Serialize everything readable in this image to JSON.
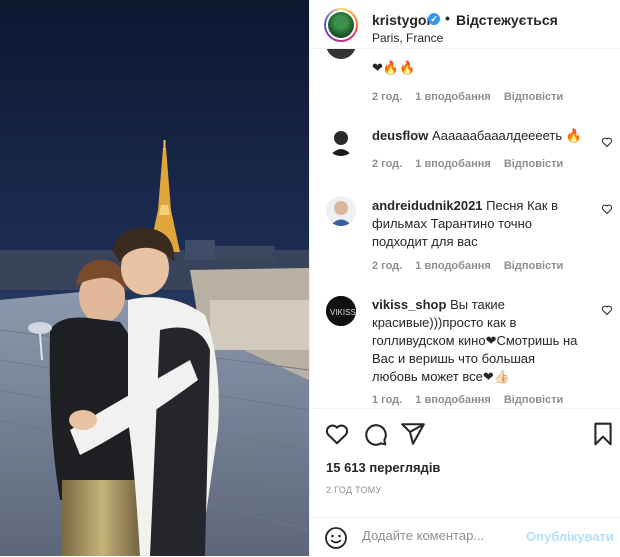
{
  "post": {
    "username": "kristygor",
    "verified": true,
    "separator": "•",
    "follow_status": "Відстежується",
    "location": "Paris, France"
  },
  "comments": [
    {
      "username": "",
      "text": "❤🔥🔥",
      "time": "2 год.",
      "likes": "1 вподобання",
      "reply": "Відповісти"
    },
    {
      "username": "deusflow",
      "text": "Аааааабааалдееееть 🔥",
      "time": "2 год.",
      "likes": "1 вподобання",
      "reply": "Відповісти"
    },
    {
      "username": "andreidudnik2021",
      "text": "Песня Как в фильмах Тарантино точно подходит для вас",
      "time": "2 год.",
      "likes": "1 вподобання",
      "reply": "Відповісти"
    },
    {
      "username": "vikiss_shop",
      "text": "Вы такие красивые)))просто как в голливудском кино❤Смотришь на Вас и веришь что большая любовь может все❤👍🏻",
      "time": "1 год.",
      "likes": "1 вподобання",
      "reply": "Відповісти"
    }
  ],
  "stats": {
    "views": "15 613 переглядів",
    "time_ago": "2 ГОД ТОМУ"
  },
  "add_comment": {
    "placeholder": "Додайте коментар...",
    "publish_label": "Опублікувати"
  },
  "icons": {
    "like": "heart-icon",
    "comment": "comment-icon",
    "share": "share-icon",
    "save": "bookmark-icon",
    "emoji": "emoji-icon"
  },
  "colors": {
    "verified": "#3897f0",
    "publish_disabled": "#b2dffc",
    "meta_text": "#8e8e8e"
  }
}
